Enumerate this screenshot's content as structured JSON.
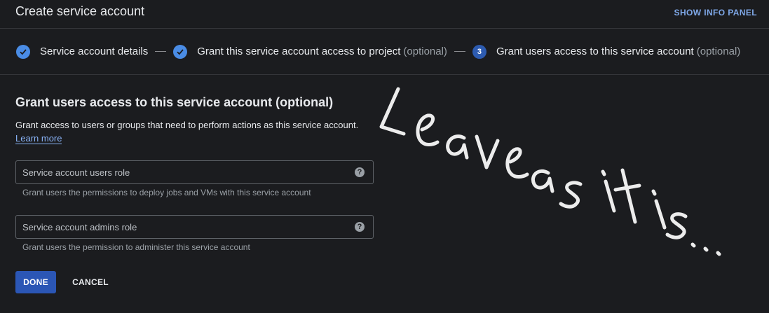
{
  "header": {
    "title": "Create service account",
    "info_panel_label": "SHOW INFO PANEL"
  },
  "stepper": {
    "steps": [
      {
        "label": "Service account details",
        "optional": "",
        "status": "complete"
      },
      {
        "label": "Grant this service account access to project",
        "optional": "(optional)",
        "status": "complete"
      },
      {
        "label": "Grant users access to this service account",
        "optional": "(optional)",
        "status": "current",
        "number": "3"
      }
    ]
  },
  "section": {
    "title": "Grant users access to this service account (optional)",
    "description": "Grant access to users or groups that need to perform actions as this service account.",
    "learn_more": "Learn more"
  },
  "fields": [
    {
      "placeholder": "Service account users role",
      "value": "",
      "hint": "Grant users the permissions to deploy jobs and VMs with this service account",
      "help": "?"
    },
    {
      "placeholder": "Service account admins role",
      "value": "",
      "hint": "Grant users the permission to administer this service account",
      "help": "?"
    }
  ],
  "actions": {
    "done_label": "DONE",
    "cancel_label": "CANCEL"
  },
  "annotation": {
    "text": "Leave as it is...",
    "color": "#ececec"
  },
  "colors": {
    "background": "#1b1c1f",
    "accent": "#4a8ce5",
    "primary_button": "#2b56b5",
    "link": "#8ab4f8"
  }
}
